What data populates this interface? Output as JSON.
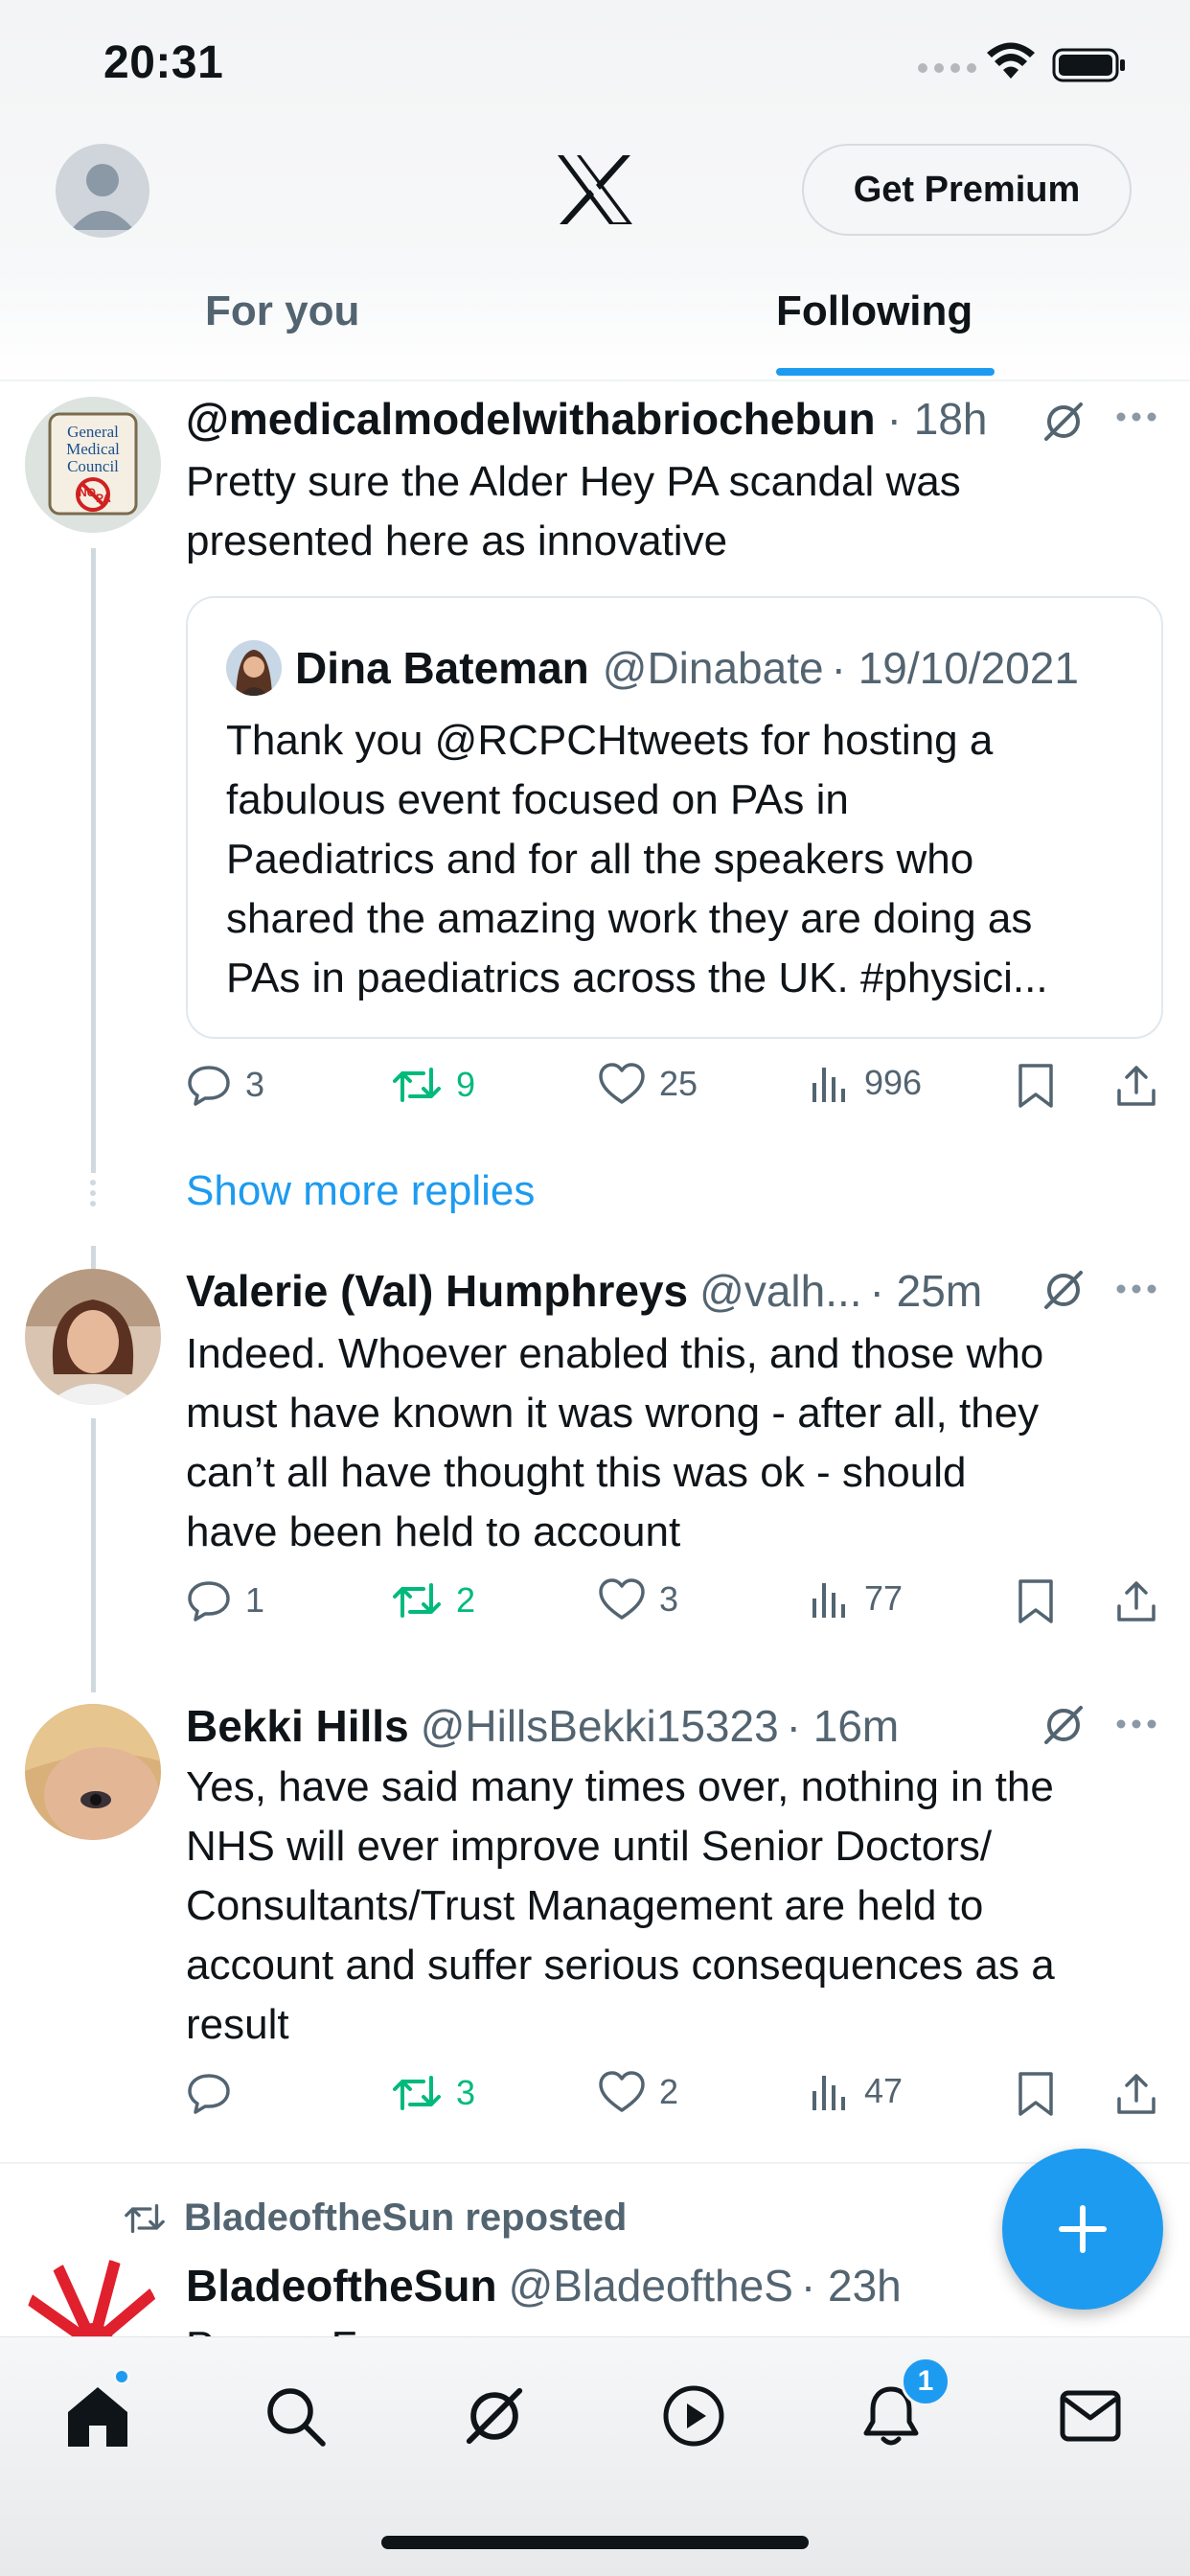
{
  "status_bar": {
    "time": "20:31"
  },
  "header": {
    "premium_label": "Get Premium",
    "tabs": [
      {
        "label": "For you",
        "active": false
      },
      {
        "label": "Following",
        "active": true
      }
    ]
  },
  "tweets": [
    {
      "name": "@medicalmodelwithabriochebun",
      "handle": "",
      "time": "· 18h",
      "avatar_text": [
        "General",
        "Medical",
        "Council",
        "NO",
        "PA"
      ],
      "text": [
        "Pretty sure the Alder Hey PA scandal was",
        "presented here as innovative"
      ],
      "quote": {
        "name": "Dina Bateman",
        "handle": "@Dinabate",
        "date": "· 19/10/2021",
        "text": [
          "Thank you @RCPCHtweets for hosting a",
          "fabulous event focused on PAs in",
          "Paediatrics and for all the speakers who",
          "shared the amazing work they are doing as",
          "PAs in paediatrics across the UK. #physici..."
        ]
      },
      "stats": {
        "replies": "3",
        "reposts": "9",
        "likes": "25",
        "views": "996"
      }
    },
    {
      "name": "Valerie (Val) Humphreys",
      "handle": "@valh...",
      "time": "· 25m",
      "text": [
        "Indeed. Whoever enabled this, and those who",
        "must have known it was wrong - after all, they",
        "can’t all have thought this was ok - should",
        "have been held to account"
      ],
      "stats": {
        "replies": "1",
        "reposts": "2",
        "likes": "3",
        "views": "77"
      }
    },
    {
      "name": "Bekki Hills",
      "handle": "@HillsBekki15323",
      "time": "· 16m",
      "text": [
        "Yes, have said many times over, nothing in the",
        "NHS will ever improve until Senior Doctors/",
        "Consultants/Trust Management are held to",
        "account and suffer serious consequences as a",
        "result"
      ],
      "stats": {
        "replies": "",
        "reposts": "3",
        "likes": "2",
        "views": "47"
      }
    },
    {
      "name": "BladeoftheSun",
      "handle": "@BladeoftheS",
      "time": "· 23h",
      "text": [
        "Pan on Fe..."
      ],
      "stats": {}
    }
  ],
  "show_more_replies": "Show more replies",
  "repost_label": "BladeoftheSun reposted",
  "nav": {
    "notification_count": "1"
  },
  "colors": {
    "accent": "#1d9bf0",
    "repost_green": "#00ba7c",
    "secondary_text": "#536471"
  },
  "icons": [
    "x-logo-icon",
    "grok-icon",
    "more-icon",
    "reply-icon",
    "repost-icon",
    "like-icon",
    "views-icon",
    "bookmark-icon",
    "share-icon",
    "compose-icon",
    "home-icon",
    "search-icon",
    "notifications-icon",
    "messages-icon",
    "video-icon"
  ]
}
